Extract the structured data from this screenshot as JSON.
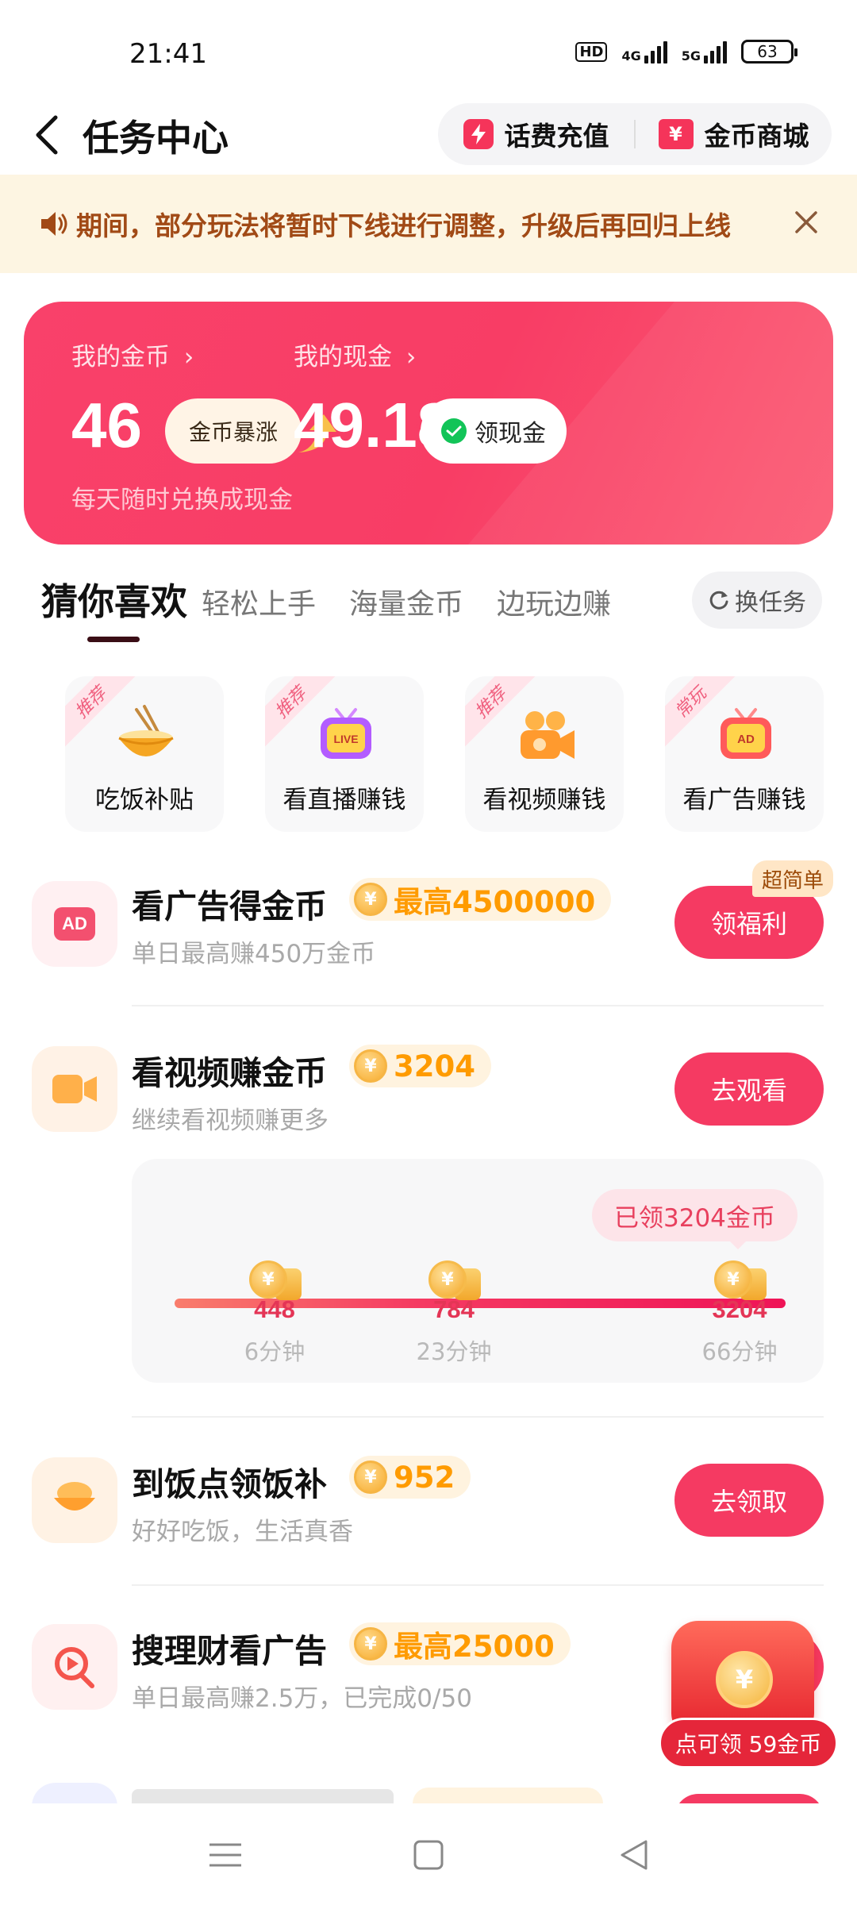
{
  "status_bar": {
    "time": "21:41",
    "hd_label": "HD",
    "net_1": "4G",
    "net_2": "5G",
    "battery": "63"
  },
  "header": {
    "title": "任务中心",
    "recharge_label": "话费充值",
    "mall_label": "金币商城"
  },
  "notice": {
    "text": "期间，部分玩法将暂时下线进行调整，升级后再回归上线"
  },
  "balance": {
    "coins_label": "我的金币",
    "coins_value": "46",
    "coins_badge": "金币暴涨",
    "coins_hint": "每天随时兑换成现金",
    "cash_label": "我的现金",
    "cash_value": "49.18",
    "cash_button": "领现金"
  },
  "tabs": {
    "items": [
      "猜你喜欢",
      "轻松上手",
      "海量金币",
      "边玩边赚"
    ],
    "swap_label": "换任务"
  },
  "grid": [
    {
      "tag": "推荐",
      "label": "吃饭补贴"
    },
    {
      "tag": "推荐",
      "label": "看直播赚钱"
    },
    {
      "tag": "推荐",
      "label": "看视频赚钱"
    },
    {
      "tag": "常玩",
      "label": "看广告赚钱"
    }
  ],
  "tasks": [
    {
      "title": "看广告得金币",
      "reward": "最高4500000",
      "subtitle": "单日最高赚450万金币",
      "button": "领福利",
      "corner": "超简单"
    },
    {
      "title": "看视频赚金币",
      "reward": "3204",
      "subtitle": "继续看视频赚更多",
      "button": "去观看"
    },
    {
      "title": "到饭点领饭补",
      "reward": "952",
      "subtitle": "好好吃饭，生活真香",
      "button": "去领取"
    },
    {
      "title": "搜理财看广告",
      "reward": "最高25000",
      "subtitle": "单日最高赚2.5万，已完成0/50"
    }
  ],
  "progress": {
    "claimed": "已领3204金币",
    "nodes": [
      {
        "value": "448",
        "time": "6分钟"
      },
      {
        "value": "784",
        "time": "23分钟"
      },
      {
        "value": "3204",
        "time": "66分钟"
      }
    ]
  },
  "floating": {
    "label": "点可领 59金币"
  },
  "icons": {
    "coin_glyph": "¥",
    "ad_text": "AD",
    "live_text": "LIVE"
  },
  "colors": {
    "accent": "#f53a62",
    "reward": "#ff9b00",
    "notice_text": "#a14a16"
  }
}
